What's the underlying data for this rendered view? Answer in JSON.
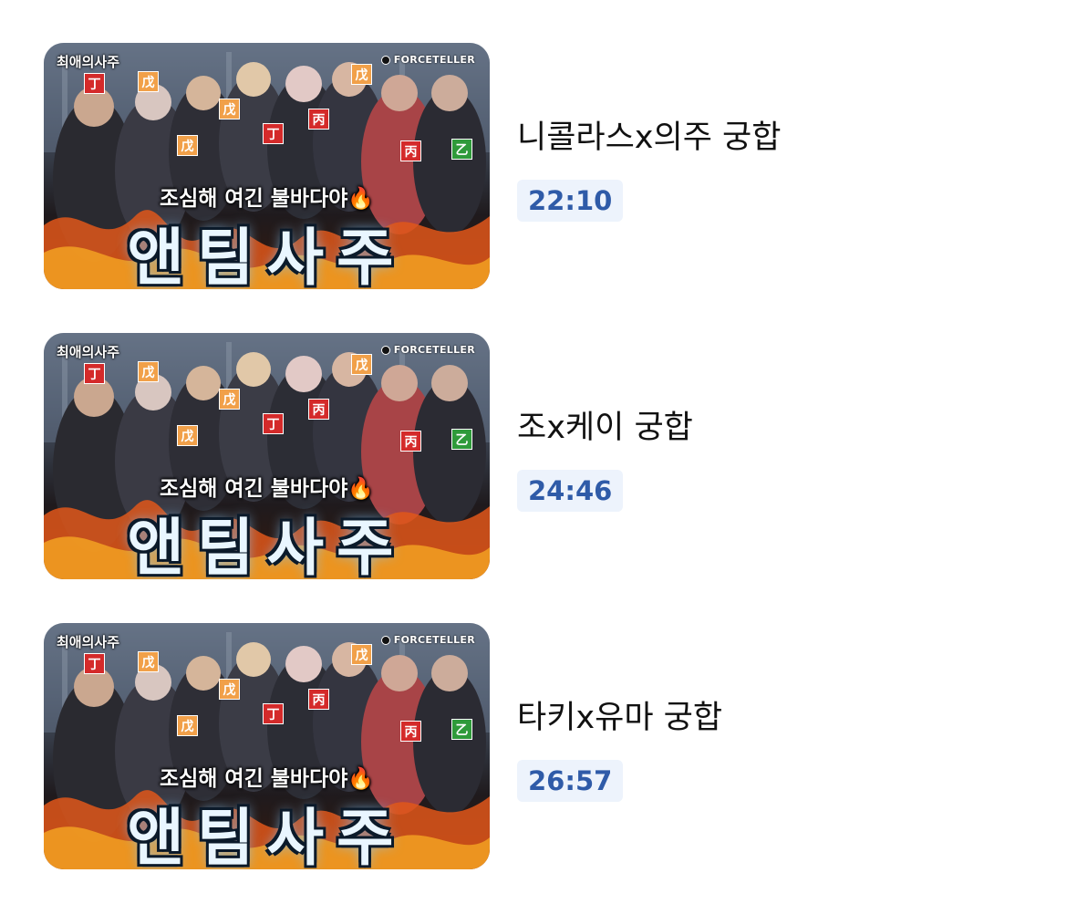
{
  "colors": {
    "duration_text": "#2f5ba8",
    "duration_bg": "#edf3fc",
    "badge_red": "#d42a2a",
    "badge_orange": "#f1a049",
    "badge_green": "#2f9a3a"
  },
  "thumbnail": {
    "channel_tag": "최애의사주",
    "brand": "FORCETELLER",
    "brand_icon": "circle-logo-icon",
    "badges": [
      "丁",
      "戊",
      "戊",
      "戊",
      "丁",
      "丙",
      "戊",
      "丙",
      "乙"
    ],
    "subtitle": "조심해 여긴 불바다야",
    "subtitle_icon": "🔥",
    "big_title": "앤팀사주"
  },
  "videos": [
    {
      "title": "니콜라스x의주 궁합",
      "duration": "22:10"
    },
    {
      "title": "조x케이 궁합",
      "duration": "24:46"
    },
    {
      "title": "타키x유마 궁합",
      "duration": "26:57"
    }
  ]
}
